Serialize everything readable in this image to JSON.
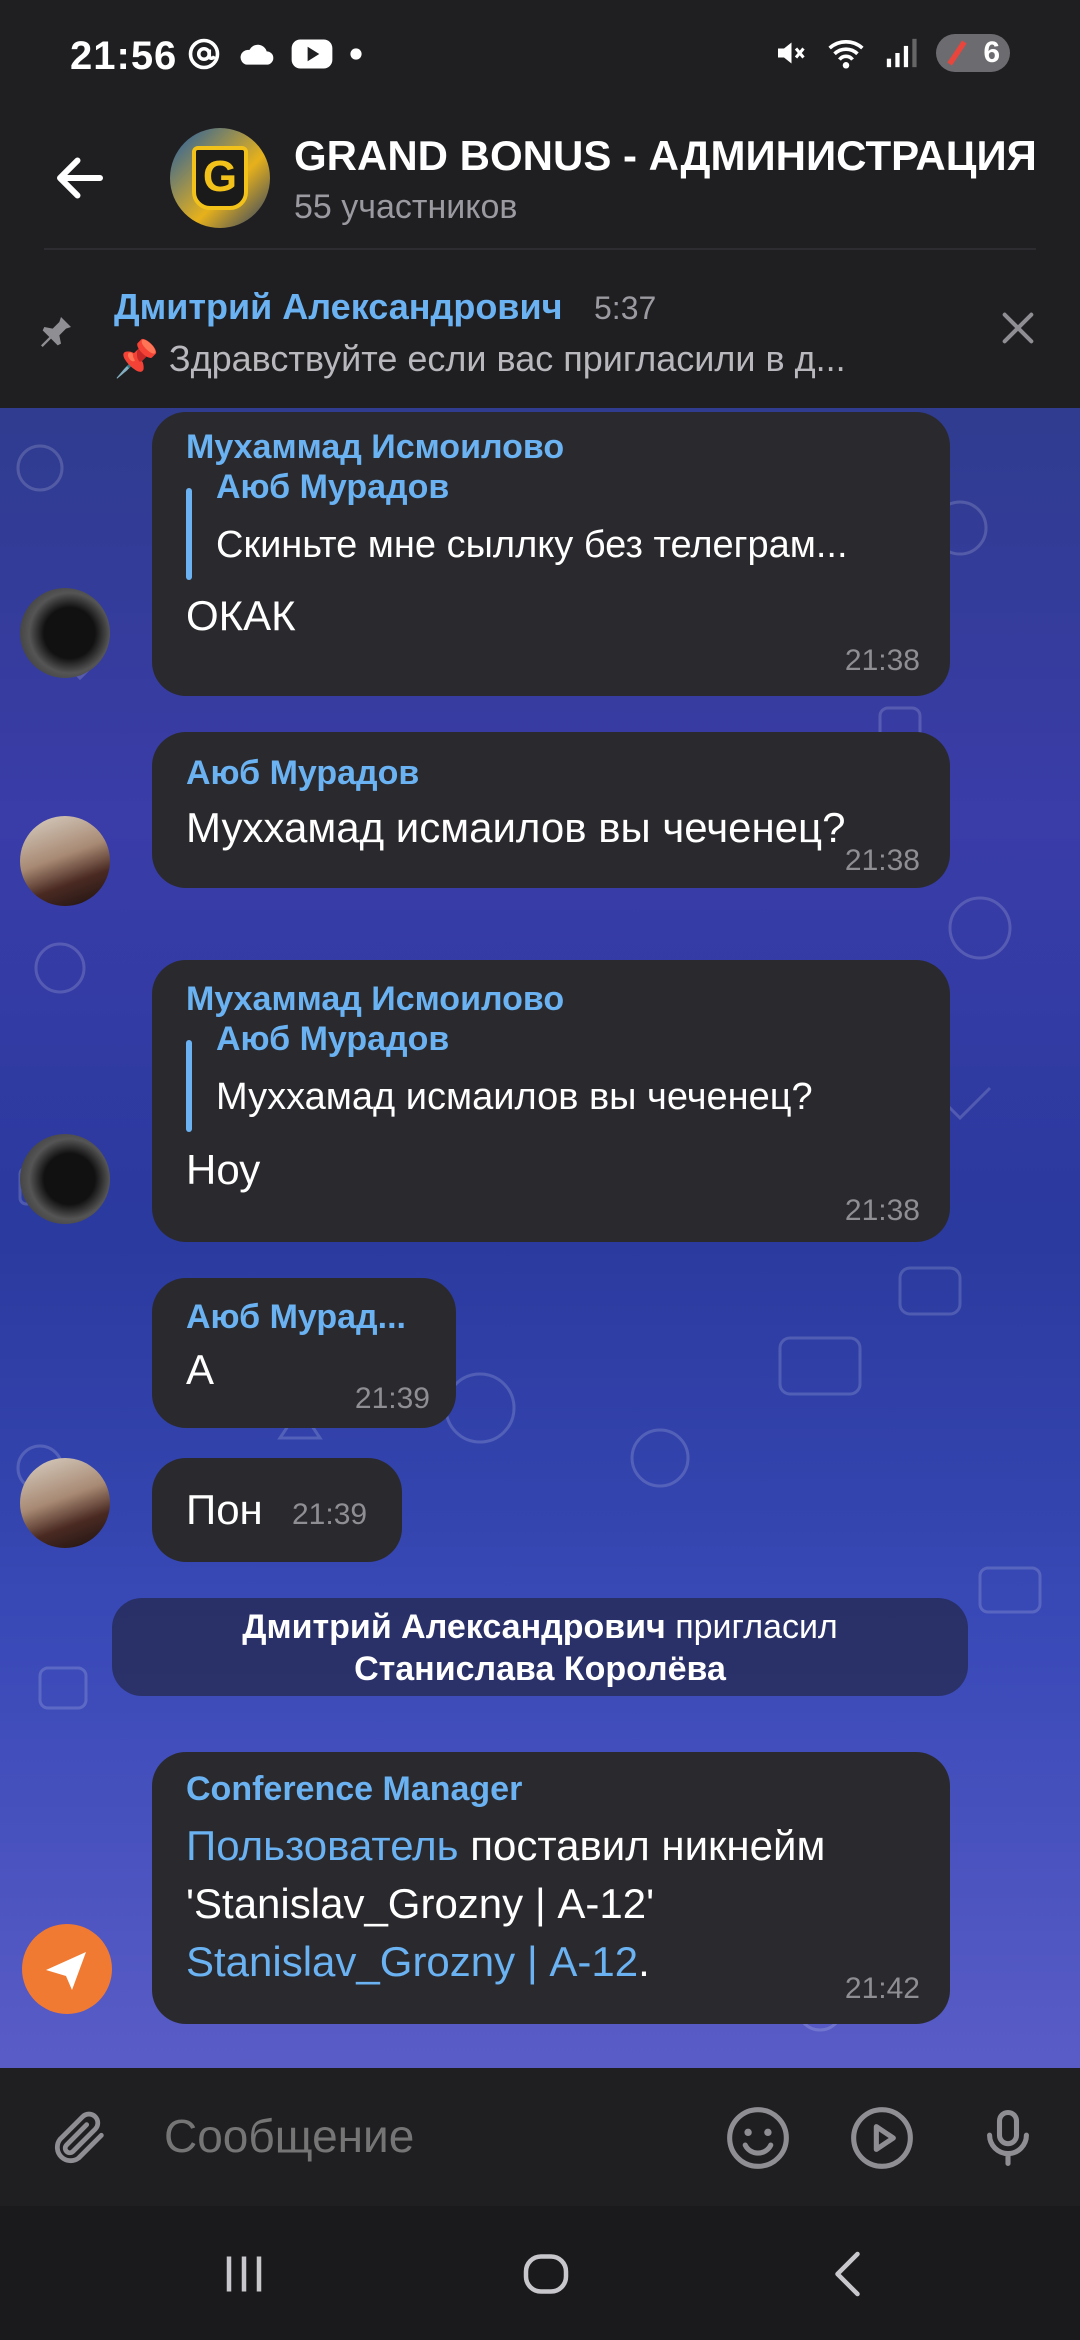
{
  "status_bar": {
    "time": "21:56",
    "battery": "6"
  },
  "header": {
    "title": "GRAND BONUS - АДМИНИСТРАЦИЯ",
    "subtitle": "55 участников",
    "avatar_letter": "G"
  },
  "pinned": {
    "author": "Дмитрий Александрович",
    "time": "5:37",
    "text": "📌 Здравствуйте если вас пригласили в д..."
  },
  "messages": [
    {
      "sender": "Мухаммад Исмоилово",
      "reply_name": "Аюб Мурадов",
      "reply_text": "Скиньте мне сыллку без телеграм...",
      "text": "ОКАК",
      "time": "21:38"
    },
    {
      "sender": "Аюб Мурадов",
      "text": "Муххамад исмаилов вы чеченец?",
      "time": "21:38"
    },
    {
      "sender": "Мухаммад Исмоилово",
      "reply_name": "Аюб Мурадов",
      "reply_text": "Муххамад исмаилов вы чеченец?",
      "text": "Ноу",
      "time": "21:38"
    },
    {
      "sender": "Аюб Мурад...",
      "text": "А",
      "time": "21:39"
    },
    {
      "text": "Пон",
      "time": "21:39"
    }
  ],
  "system_message": {
    "actor": "Дмитрий Александрович",
    "action": " пригласил",
    "target": "Станислава Королёва"
  },
  "bot_message": {
    "sender": "Conference Manager",
    "link_user": "Пользователь",
    "text_1": " поставил никнейм",
    "text_2": "'Stanislav_Grozny | А-12'",
    "link_nick": "Stanislav_Grozny | А-12",
    "text_3": ".",
    "time": "21:42"
  },
  "input": {
    "placeholder": "Сообщение"
  },
  "icons": {
    "back": "arrow-left-icon",
    "pin": "pin-icon",
    "close": "close-icon",
    "attach": "paperclip-icon",
    "emoji": "emoji-icon",
    "video": "play-circle-icon",
    "mic": "microphone-icon"
  },
  "colors": {
    "accent": "#6ab2f2",
    "bubble": "#2a2a2e",
    "fab": "#f07a32"
  }
}
